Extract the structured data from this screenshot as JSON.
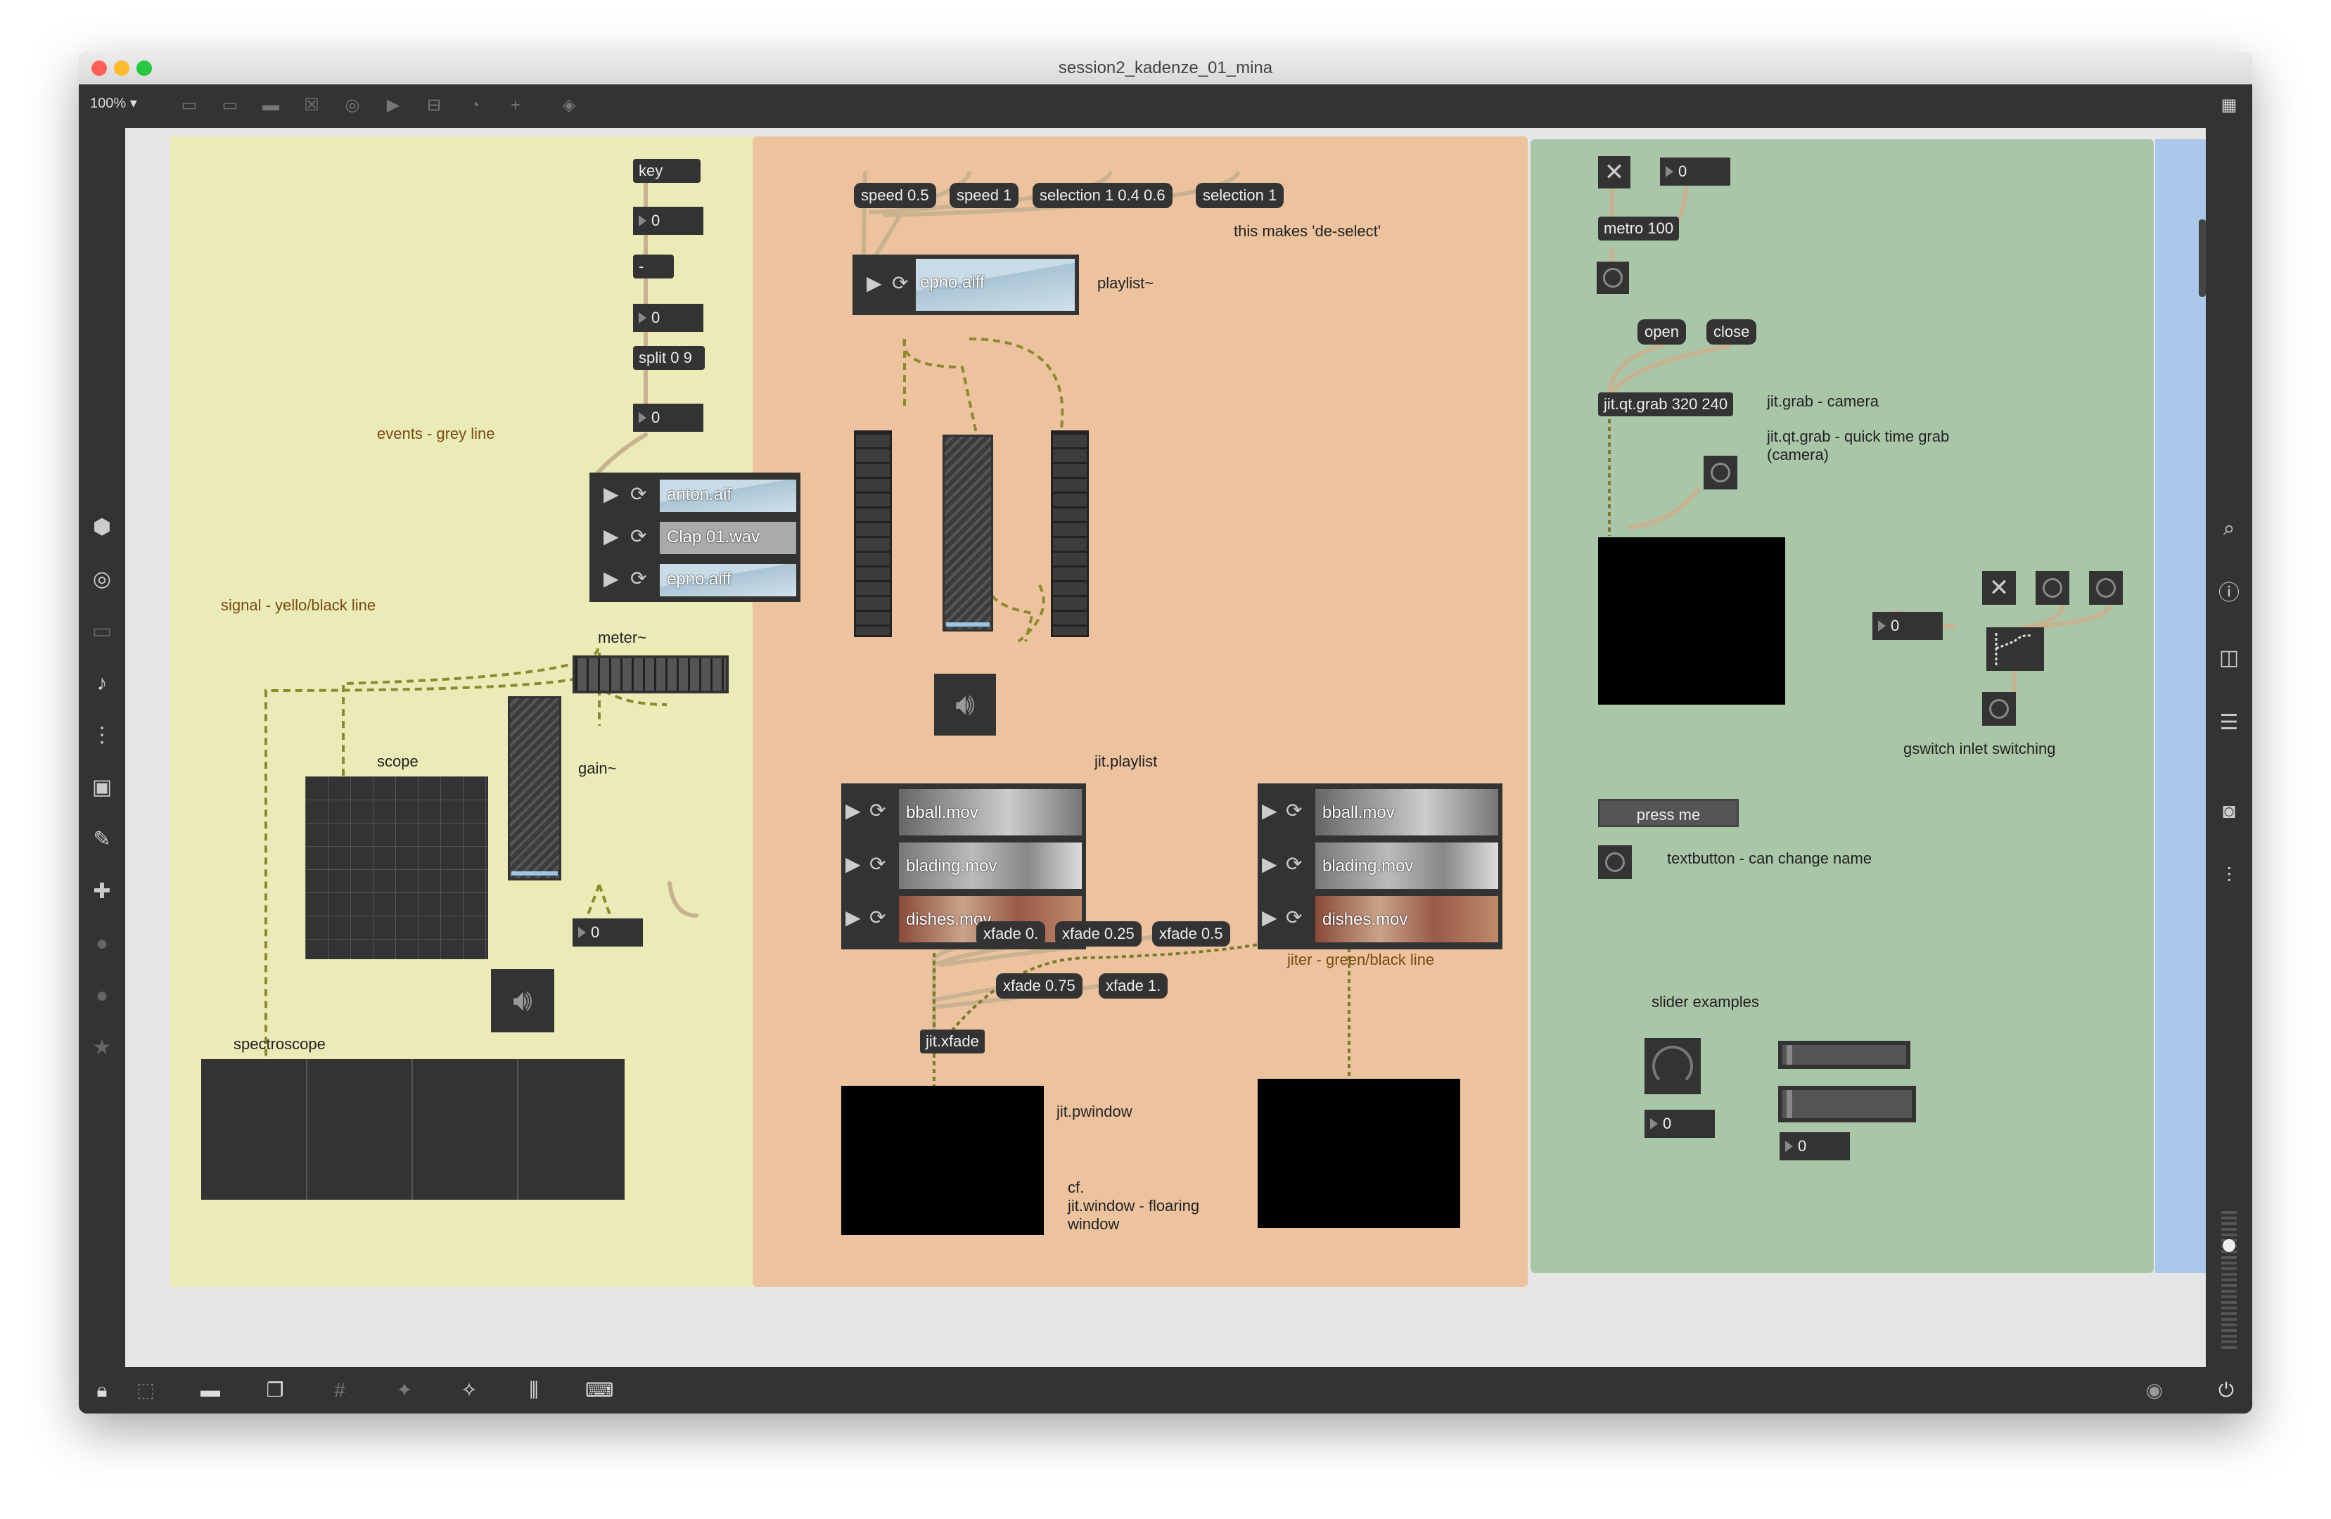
{
  "window": {
    "title": "session2_kadenze_01_mina",
    "zoom": "100%",
    "traffic_lights": {
      "close": "#ff5f57",
      "minimize": "#febc2e",
      "maximize": "#28c840"
    }
  },
  "colors": {
    "panel_yellow": "#ebebb8",
    "panel_orange": "#ecc39e",
    "panel_green": "#a9c6a8",
    "panel_blue": "#a9c8ea",
    "object_bg": "#333333",
    "wire_signal": "#8c8a2e",
    "wire_event": "#c9b28f"
  },
  "section_yellow": {
    "key_box": "key",
    "num1": "0",
    "minus_box": "-",
    "num2": "0",
    "split_box": "split 0 9",
    "num3": "0",
    "label_events": "events - grey line",
    "playlist_files": [
      "anton.aif",
      "Clap 01.wav",
      "epno.aiff"
    ],
    "label_signal": "signal - yello/black line",
    "label_meter": "meter~",
    "label_scope": "scope",
    "label_gain": "gain~",
    "num_gain": "0",
    "label_spectroscope": "spectroscope"
  },
  "section_orange": {
    "messages": [
      "speed 0.5",
      "speed 1",
      "selection 1 0.4 0.6",
      "selection 1"
    ],
    "label_deselect": "this makes 'de-select'",
    "playlist_file": "epno.aiff",
    "label_playlist": "playlist~",
    "jit_playlist_left": [
      "bball.mov",
      "blading.mov",
      "dishes.mov"
    ],
    "jit_playlist_right": [
      "bball.mov",
      "blading.mov",
      "dishes.mov"
    ],
    "label_jit_playlist": "jit.playlist",
    "label_jiter": "jiter - green/black line",
    "xfade_row1": [
      "xfade 0.",
      "xfade 0.25",
      "xfade 0.5"
    ],
    "xfade_row2": [
      "xfade 0.75",
      "xfade 1."
    ],
    "xfade_box": "jit.xfade",
    "label_pwindow": "jit.pwindow",
    "label_cf_line1": "cf.",
    "label_cf_line2": "jit.window - floaring",
    "label_cf_line3": "window"
  },
  "section_green": {
    "num_top": "0",
    "metro_box": "metro 100",
    "msg_open": "open",
    "msg_close": "close",
    "grab_box": "jit.qt.grab 320 240",
    "label_grab1": "jit.grab - camera",
    "label_grab2_line1": "jit.qt.grab - quick time grab",
    "label_grab2_line2": "(camera)",
    "num_gswitch": "0",
    "label_gswitch": "gswitch inlet switching",
    "textbutton_label": "press me",
    "label_textbutton": "textbutton - can change name",
    "label_sliders": "slider examples",
    "num_dial": "0",
    "num_slider": "0"
  }
}
